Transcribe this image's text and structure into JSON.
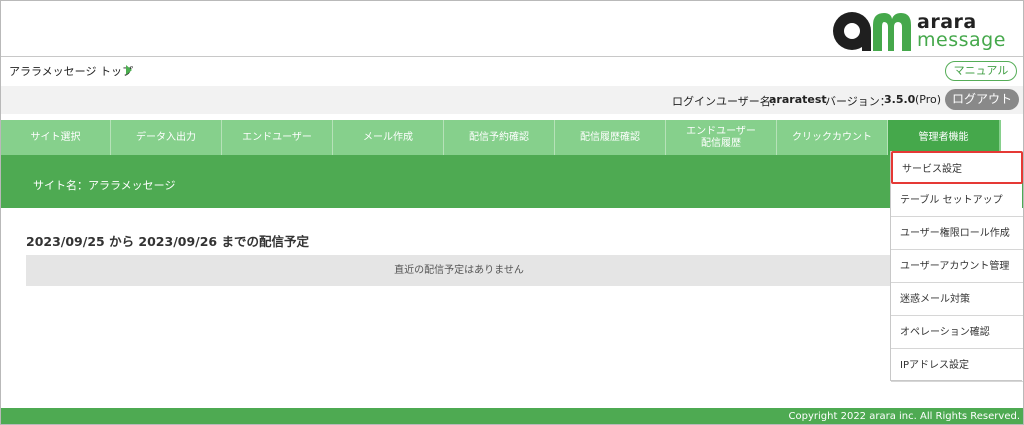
{
  "header": {
    "logo_line1": "arara",
    "logo_line2": "message",
    "logo_mark": "am",
    "brand_colors": {
      "dark": "#1f1f1f",
      "green": "#45a84b"
    }
  },
  "breadcrumb": {
    "current": "アララメッセージ トップ"
  },
  "manual_label": "マニュアル",
  "login": {
    "user_label": "ログインユーザー名：",
    "user_name": "araratest",
    "version_label": "バージョン：",
    "version": "3.5.0",
    "edition": "(Pro)",
    "logout_label": "ログアウト"
  },
  "nav": {
    "items": [
      {
        "label": "サイト選択"
      },
      {
        "label": "データ入出力"
      },
      {
        "label": "エンドユーザー"
      },
      {
        "label": "メール作成"
      },
      {
        "label": "配信予約確認"
      },
      {
        "label": "配信履歴確認"
      },
      {
        "label": "エンドユーザー配信履歴",
        "line1": "エンドユーザー",
        "line2": "配信履歴"
      },
      {
        "label": "クリックカウント"
      },
      {
        "label": "管理者機能"
      }
    ]
  },
  "site": {
    "label": "サイト名：アララメッセージ"
  },
  "schedule": {
    "title": "2023/09/25 から 2023/09/26 までの配信予定",
    "empty_message": "直近の配信予定はありません"
  },
  "admin_menu": {
    "items": [
      {
        "label": "サービス設定"
      },
      {
        "label": "テーブル セットアップ"
      },
      {
        "label": "ユーザー権限ロール作成"
      },
      {
        "label": "ユーザーアカウント管理"
      },
      {
        "label": "迷惑メール対策"
      },
      {
        "label": "オペレーション確認"
      },
      {
        "label": "IPアドレス設定"
      }
    ]
  },
  "footer": {
    "copyright": "Copyright 2022 arara inc. All Rights Reserved."
  },
  "colors": {
    "nav_bg": "#86d08c",
    "nav_active": "#45a84b",
    "band": "#4eaa52",
    "highlight": "#e53935"
  }
}
